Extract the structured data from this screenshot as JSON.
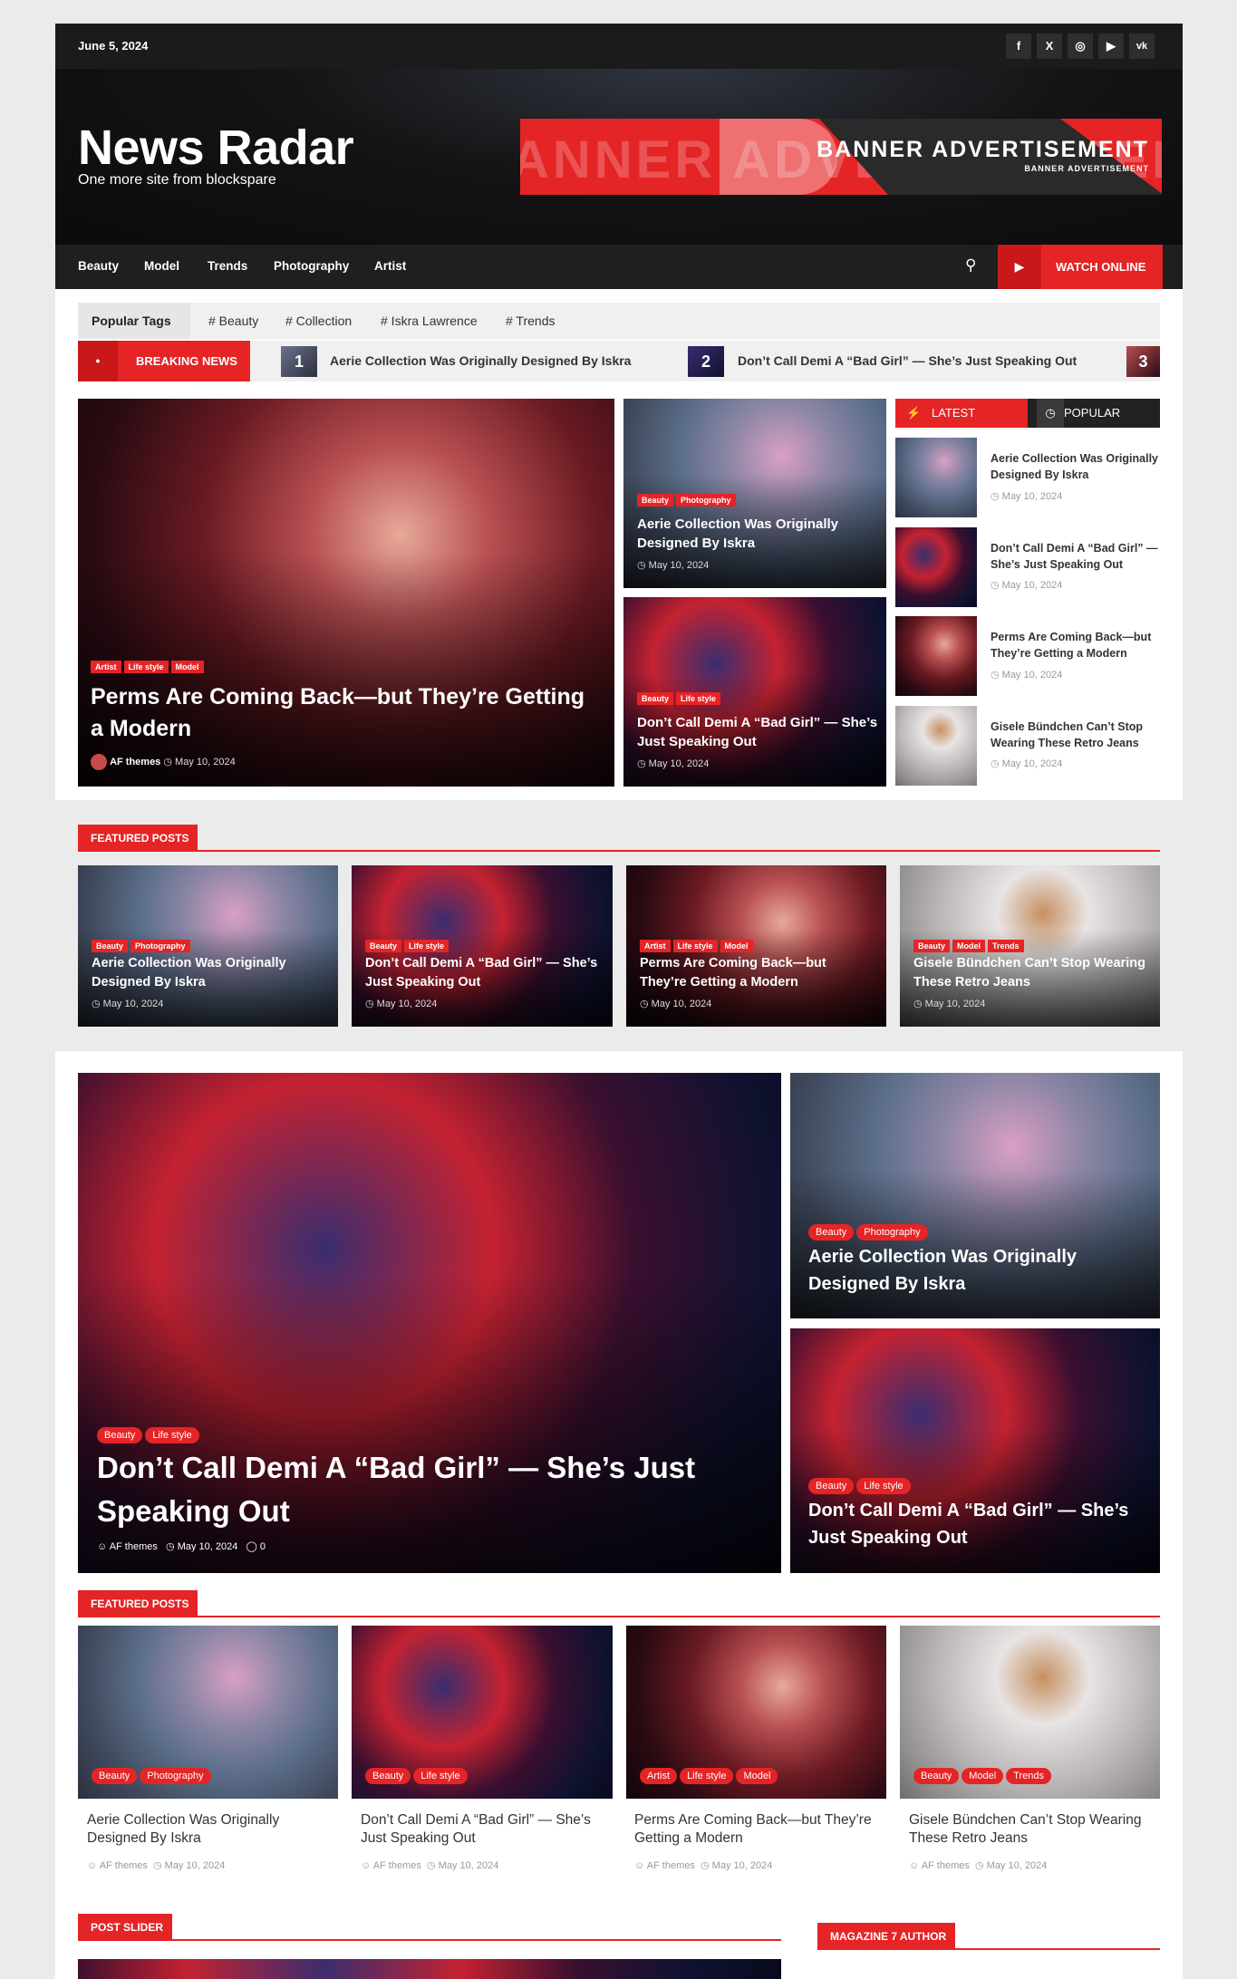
{
  "topbar": {
    "date": "June 5, 2024",
    "social": [
      "f",
      "X",
      "◎",
      "▶",
      "vk"
    ]
  },
  "header": {
    "site_title": "News Radar",
    "tagline": "One more site from blockspare",
    "banner": {
      "bg_text": "ANNER ADVERTISEMEN",
      "main": "BANNER ADVERTISEMENT",
      "sub": "BANNER ADVERTISEMENT"
    }
  },
  "nav": {
    "items": [
      "Beauty",
      "Model",
      "Trends",
      "Photography",
      "Artist"
    ],
    "watch_label": "WATCH ONLINE"
  },
  "popular_tags": {
    "label": "Popular Tags",
    "tags": [
      "# Beauty",
      "# Collection",
      "# Iskra Lawrence",
      "# Trends"
    ]
  },
  "breaking": {
    "label": "BREAKING NEWS",
    "items": [
      {
        "num": "1",
        "title": "Aerie Collection Was Originally Designed By Iskra"
      },
      {
        "num": "2",
        "title": "Don’t Call Demi A “Bad Girl” — She’s Just Speaking Out"
      },
      {
        "num": "3",
        "title": ""
      }
    ]
  },
  "hero": {
    "main": {
      "cats": [
        "Artist",
        "Life style",
        "Model"
      ],
      "title": "Perms Are Coming Back—but They’re Getting a Modern",
      "author": "AF themes",
      "date": "May 10, 2024"
    },
    "mid1": {
      "cats": [
        "Beauty",
        "Photography"
      ],
      "title": "Aerie Collection Was Originally Designed By Iskra",
      "date": "May 10, 2024"
    },
    "mid2": {
      "cats": [
        "Beauty",
        "Life style"
      ],
      "title": "Don’t Call Demi A “Bad Girl” — She’s Just Speaking Out",
      "date": "May 10, 2024"
    }
  },
  "tabs": {
    "latest": "LATEST",
    "popular": "POPULAR",
    "items": [
      {
        "title": "Aerie Collection Was Originally Designed By Iskra",
        "date": "May 10, 2024"
      },
      {
        "title": "Don’t Call Demi A “Bad Girl” — She’s Just Speaking Out",
        "date": "May 10, 2024"
      },
      {
        "title": "Perms Are Coming Back—but They’re Getting a Modern",
        "date": "May 10, 2024"
      },
      {
        "title": "Gisele Bündchen Can’t Stop Wearing These Retro Jeans",
        "date": "May 10, 2024"
      }
    ]
  },
  "featured1": {
    "label": "FEATURED POSTS",
    "cards": [
      {
        "cats": [
          "Beauty",
          "Photography"
        ],
        "title": "Aerie Collection Was Originally Designed By Iskra",
        "date": "May 10, 2024"
      },
      {
        "cats": [
          "Beauty",
          "Life style"
        ],
        "title": "Don’t Call Demi A “Bad Girl” — She’s Just Speaking Out",
        "date": "May 10, 2024"
      },
      {
        "cats": [
          "Artist",
          "Life style",
          "Model"
        ],
        "title": "Perms Are Coming Back—but They’re Getting a Modern",
        "date": "May 10, 2024"
      },
      {
        "cats": [
          "Beauty",
          "Model",
          "Trends"
        ],
        "title": "Gisele Bündchen Can’t Stop Wearing These Retro Jeans",
        "date": "May 10, 2024"
      }
    ]
  },
  "big": {
    "main": {
      "cats": [
        "Beauty",
        "Life style"
      ],
      "title": "Don’t Call Demi A “Bad Girl” — She’s Just Speaking Out",
      "author": "AF themes",
      "date": "May 10, 2024",
      "comments": "0"
    },
    "right1": {
      "cats": [
        "Beauty",
        "Photography"
      ],
      "title": "Aerie Collection Was Originally Designed By Iskra"
    },
    "right2": {
      "cats": [
        "Beauty",
        "Life style"
      ],
      "title": "Don’t Call Demi A “Bad Girl” — She’s Just Speaking Out"
    }
  },
  "featured2": {
    "label": "FEATURED POSTS",
    "cards": [
      {
        "cats": [
          "Beauty",
          "Photography"
        ],
        "title": "Aerie Collection Was Originally Designed By Iskra",
        "author": "AF themes",
        "date": "May 10, 2024"
      },
      {
        "cats": [
          "Beauty",
          "Life style"
        ],
        "title": "Don’t Call Demi A “Bad Girl” — She’s Just Speaking Out",
        "author": "AF themes",
        "date": "May 10, 2024"
      },
      {
        "cats": [
          "Artist",
          "Life style",
          "Model"
        ],
        "title": "Perms Are Coming Back—but They’re Getting a Modern",
        "author": "AF themes",
        "date": "May 10, 2024"
      },
      {
        "cats": [
          "Beauty",
          "Model",
          "Trends"
        ],
        "title": "Gisele Bündchen Can’t Stop Wearing These Retro Jeans",
        "author": "AF themes",
        "date": "May 10, 2024"
      }
    ]
  },
  "post_slider": {
    "label": "POST SLIDER"
  },
  "author_widget": {
    "label": "MAGAZINE 7 AUTHOR"
  }
}
